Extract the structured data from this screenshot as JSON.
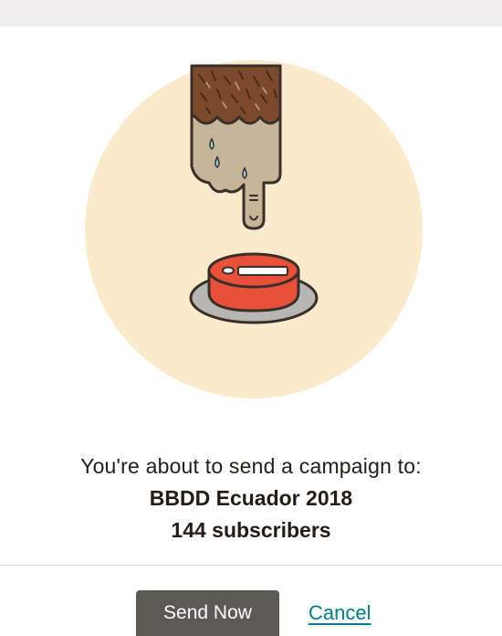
{
  "header": {
    "bar_color": "#efeeea"
  },
  "illustration": {
    "icon": "finger-pressing-red-button-icon",
    "circle_color": "#fbeacb",
    "button_color": "#e8503a"
  },
  "confirmation": {
    "intro": "You're about to send a campaign to:",
    "list_name": "BBDD Ecuador 2018",
    "subscriber_count": "144 subscribers"
  },
  "actions": {
    "send_label": "Send Now",
    "cancel_label": "Cancel",
    "send_color": "#5d5a55",
    "link_color": "#007c89"
  }
}
